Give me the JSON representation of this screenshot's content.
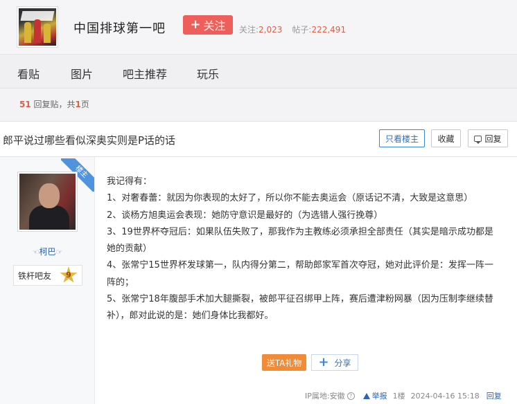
{
  "forum": {
    "name": "中国排球第一吧",
    "follow_label": "关注",
    "follow_count_label": "关注:",
    "follow_count": "2,023",
    "post_count_label": "帖子:",
    "post_count": "222,491"
  },
  "nav": {
    "items": [
      "看贴",
      "图片",
      "吧主推荐",
      "玩乐"
    ]
  },
  "summary": {
    "reply_count": "51",
    "reply_text": "回复贴，共",
    "page_count": "1",
    "page_unit": "页"
  },
  "thread": {
    "title": "郎平说过哪些看似深奥实则是P话的话",
    "only_op_label": "只看楼主",
    "collect_label": "收藏",
    "reply_label": "回复"
  },
  "post": {
    "op_tag": "楼主",
    "author": "柯巴",
    "author_deco_left": "☜",
    "author_deco_right": "☞",
    "badge_name": "铁杆吧友",
    "level": "9",
    "lines": [
      "我记得有：",
      "1、对奢春蕾：就因为你表现的太好了，所以你不能去奥运会（原话记不清，大致是这意思）",
      "2、谈杨方旭奥运会表现：她防守意识是最好的（为选错人强行挽尊）",
      "3、19世界杯夺冠后：如果队伍失败了，那我作为主教练必须承担全部责任（其实是暗示成功都是她的贡献）",
      "4、张常宁15世界杯发球第一，队内得分第二，帮助郎家军首次夺冠，她对此评价是：发挥一阵一阵的；",
      "5、张常宁18年腹部手术加大腿撕裂，被郎平征召绑甲上阵，赛后遭津粉网暴（因为压制李继续替补），郎对此说的是：她们身体比我都好。"
    ],
    "gift_label": "送TA礼物",
    "share_label": "分享",
    "ip_label": "IP属地:安徽",
    "report_label": "举报",
    "floor": "1楼",
    "time": "2024-04-16 15:18",
    "reply_label": "回复"
  }
}
